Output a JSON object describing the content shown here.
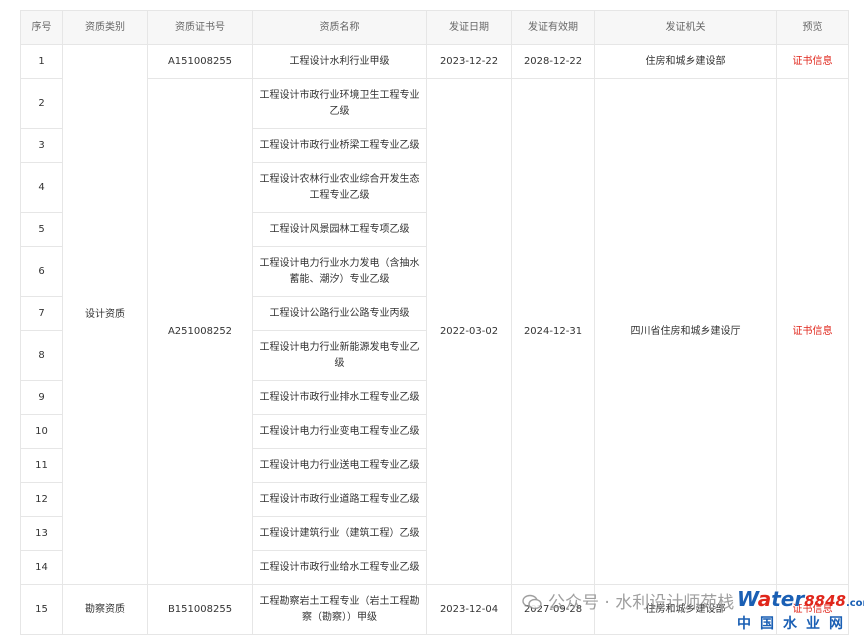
{
  "table": {
    "headers": [
      "序号",
      "资质类别",
      "资质证书号",
      "资质名称",
      "发证日期",
      "发证有效期",
      "发证机关",
      "预览"
    ],
    "groups": [
      {
        "category": "",
        "certificates": [
          {
            "cert_no": "A151008255",
            "issue_date": "2023-12-22",
            "valid_until": "2028-12-22",
            "authority": "住房和城乡建设部",
            "preview": "证书信息",
            "rows": [
              {
                "no": "1",
                "name": "工程设计水利行业甲级"
              }
            ]
          }
        ]
      },
      {
        "category": "设计资质",
        "certificates": [
          {
            "cert_no": "A251008252",
            "issue_date": "2022-03-02",
            "valid_until": "2024-12-31",
            "authority": "四川省住房和城乡建设厅",
            "preview": "证书信息",
            "rows": [
              {
                "no": "2",
                "name": "工程设计市政行业环境卫生工程专业乙级"
              },
              {
                "no": "3",
                "name": "工程设计市政行业桥梁工程专业乙级"
              },
              {
                "no": "4",
                "name": "工程设计农林行业农业综合开发生态工程专业乙级"
              },
              {
                "no": "5",
                "name": "工程设计风景园林工程专项乙级"
              },
              {
                "no": "6",
                "name": "工程设计电力行业水力发电（含抽水蓄能、潮汐）专业乙级"
              },
              {
                "no": "7",
                "name": "工程设计公路行业公路专业丙级"
              },
              {
                "no": "8",
                "name": "工程设计电力行业新能源发电专业乙级"
              },
              {
                "no": "9",
                "name": "工程设计市政行业排水工程专业乙级"
              },
              {
                "no": "10",
                "name": "工程设计电力行业变电工程专业乙级"
              },
              {
                "no": "11",
                "name": "工程设计电力行业送电工程专业乙级"
              },
              {
                "no": "12",
                "name": "工程设计市政行业道路工程专业乙级"
              },
              {
                "no": "13",
                "name": "工程设计建筑行业（建筑工程）乙级"
              },
              {
                "no": "14",
                "name": "工程设计市政行业给水工程专业乙级"
              }
            ]
          }
        ]
      },
      {
        "category": "勘察资质",
        "certificates": [
          {
            "cert_no": "B151008255",
            "issue_date": "2023-12-04",
            "valid_until": "2027-09-28",
            "authority": "住房和城乡建设部",
            "preview": "证书信息",
            "rows": [
              {
                "no": "15",
                "name": "工程勘察岩土工程专业（岩土工程勘察（勘察））甲级"
              }
            ]
          }
        ]
      }
    ]
  },
  "watermark": {
    "text": "公众号 · 水利设计师苑栈",
    "icon": "wechat-bubble-icon"
  },
  "logo": {
    "brand_w": "W",
    "brand_a": "a",
    "brand_ter": "ter",
    "brand_num": "8848",
    "brand_com": ".com",
    "subtitle": "中国水业网"
  },
  "colors": {
    "link": "#e0261b",
    "header_bg": "#f7f7f7",
    "border": "#e6e6e6",
    "logo_blue": "#1a5fb4"
  }
}
